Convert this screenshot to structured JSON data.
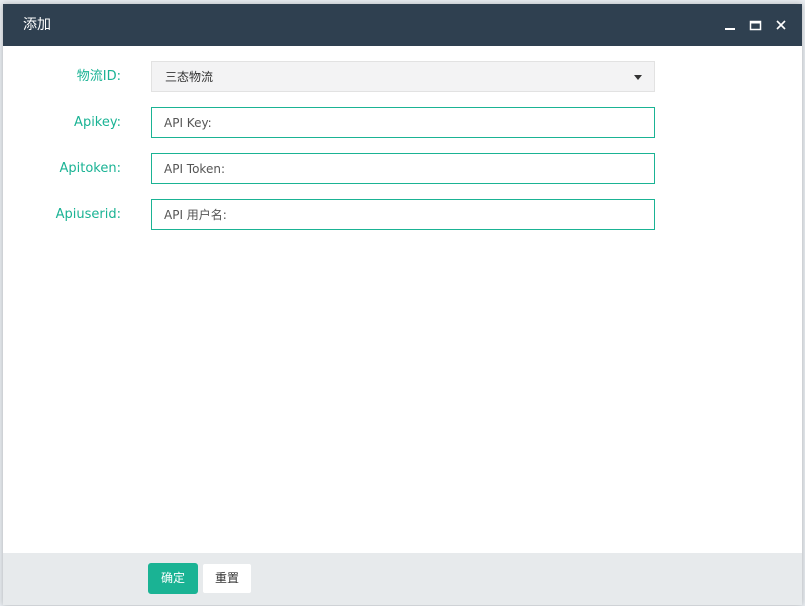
{
  "dialog": {
    "title": "添加",
    "controls": {
      "minimize_icon": "minimize-icon",
      "maximize_icon": "maximize-icon",
      "close_icon": "close-icon"
    }
  },
  "form": {
    "logistics": {
      "label": "物流ID:",
      "selected": "三态物流",
      "icon": "caret-down-icon"
    },
    "apikey": {
      "label": "Apikey:",
      "placeholder": "API Key:"
    },
    "apitoken": {
      "label": "Apitoken:",
      "placeholder": "API Token:"
    },
    "apiuserid": {
      "label": "Apiuserid:",
      "placeholder": "API 用户名:"
    }
  },
  "footer": {
    "confirm_label": "确定",
    "reset_label": "重置"
  },
  "colors": {
    "titlebar": "#2f4050",
    "accent": "#1ab394",
    "footer": "#e7eaec"
  }
}
